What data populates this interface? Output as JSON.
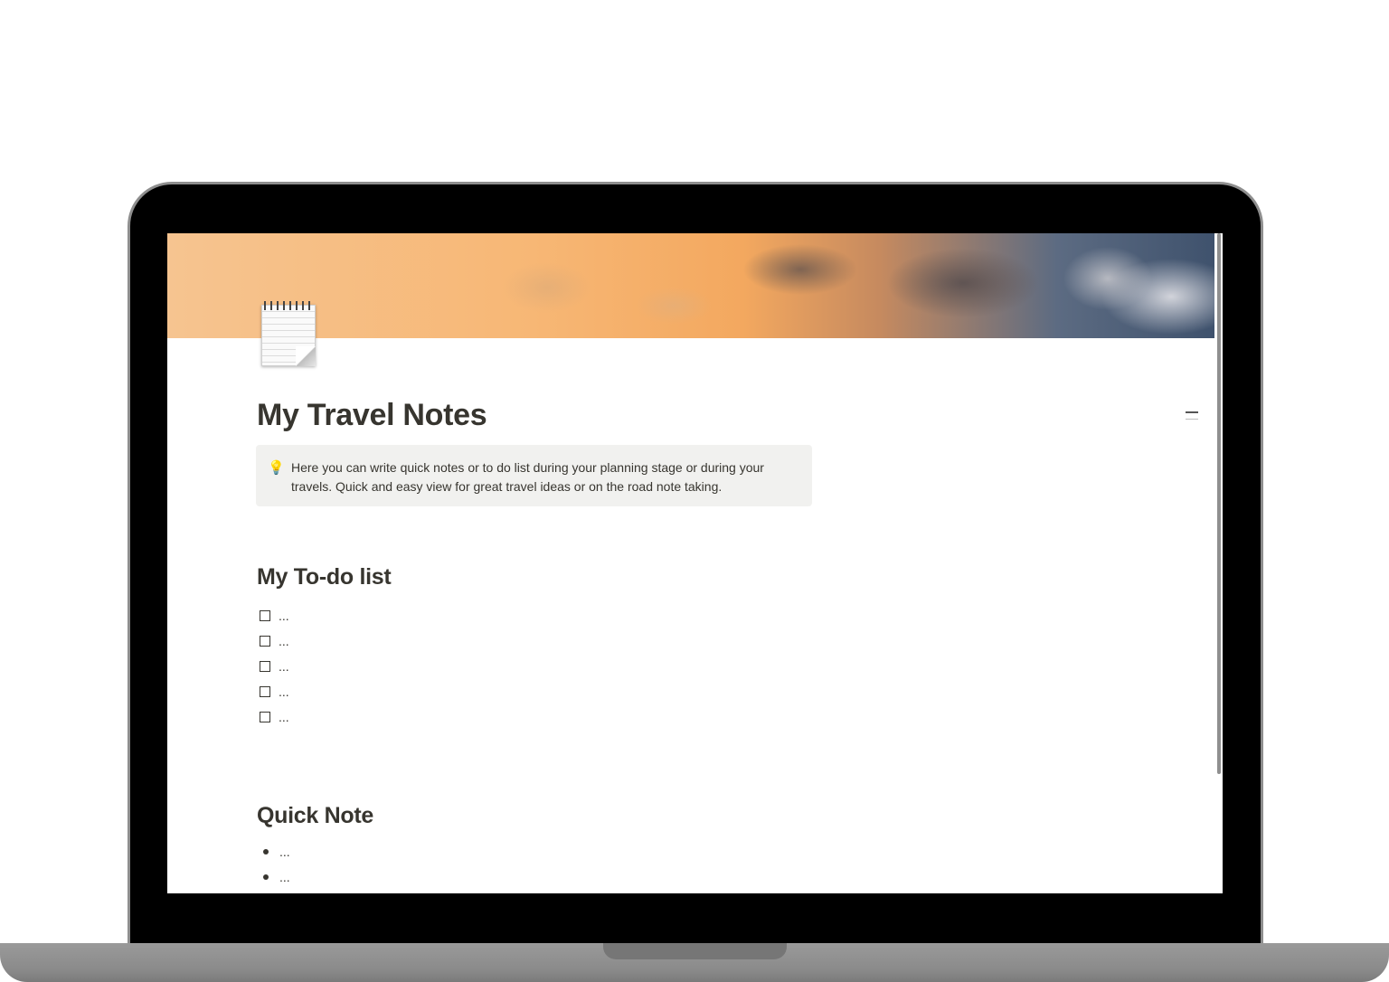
{
  "page": {
    "icon": "notepad-icon",
    "title": "My Travel Notes",
    "callout": {
      "icon": "lightbulb-icon",
      "text": "Here you can write quick notes or to do list during your planning stage or during your travels. Quick and easy view for great travel ideas or on the road note taking."
    },
    "todo_section": {
      "heading": "My To-do list",
      "items": [
        {
          "text": "...",
          "checked": false
        },
        {
          "text": "...",
          "checked": false
        },
        {
          "text": "...",
          "checked": false
        },
        {
          "text": "...",
          "checked": false
        },
        {
          "text": "...",
          "checked": false
        }
      ]
    },
    "notes_section": {
      "heading": "Quick Note",
      "items": [
        {
          "text": "..."
        },
        {
          "text": "..."
        }
      ]
    }
  },
  "colors": {
    "text": "#37352f",
    "callout_bg": "#f1f1ef",
    "bezel": "#000000"
  }
}
